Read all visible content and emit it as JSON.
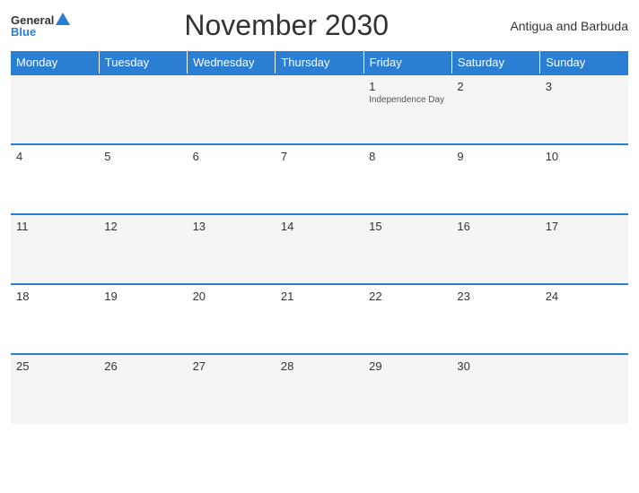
{
  "header": {
    "logo_general": "General",
    "logo_blue": "Blue",
    "title": "November 2030",
    "country": "Antigua and Barbuda"
  },
  "weekdays": [
    "Monday",
    "Tuesday",
    "Wednesday",
    "Thursday",
    "Friday",
    "Saturday",
    "Sunday"
  ],
  "weeks": [
    [
      {
        "day": "",
        "event": ""
      },
      {
        "day": "",
        "event": ""
      },
      {
        "day": "",
        "event": ""
      },
      {
        "day": "",
        "event": ""
      },
      {
        "day": "1",
        "event": "Independence Day"
      },
      {
        "day": "2",
        "event": ""
      },
      {
        "day": "3",
        "event": ""
      }
    ],
    [
      {
        "day": "4",
        "event": ""
      },
      {
        "day": "5",
        "event": ""
      },
      {
        "day": "6",
        "event": ""
      },
      {
        "day": "7",
        "event": ""
      },
      {
        "day": "8",
        "event": ""
      },
      {
        "day": "9",
        "event": ""
      },
      {
        "day": "10",
        "event": ""
      }
    ],
    [
      {
        "day": "11",
        "event": ""
      },
      {
        "day": "12",
        "event": ""
      },
      {
        "day": "13",
        "event": ""
      },
      {
        "day": "14",
        "event": ""
      },
      {
        "day": "15",
        "event": ""
      },
      {
        "day": "16",
        "event": ""
      },
      {
        "day": "17",
        "event": ""
      }
    ],
    [
      {
        "day": "18",
        "event": ""
      },
      {
        "day": "19",
        "event": ""
      },
      {
        "day": "20",
        "event": ""
      },
      {
        "day": "21",
        "event": ""
      },
      {
        "day": "22",
        "event": ""
      },
      {
        "day": "23",
        "event": ""
      },
      {
        "day": "24",
        "event": ""
      }
    ],
    [
      {
        "day": "25",
        "event": ""
      },
      {
        "day": "26",
        "event": ""
      },
      {
        "day": "27",
        "event": ""
      },
      {
        "day": "28",
        "event": ""
      },
      {
        "day": "29",
        "event": ""
      },
      {
        "day": "30",
        "event": ""
      },
      {
        "day": "",
        "event": ""
      }
    ]
  ]
}
